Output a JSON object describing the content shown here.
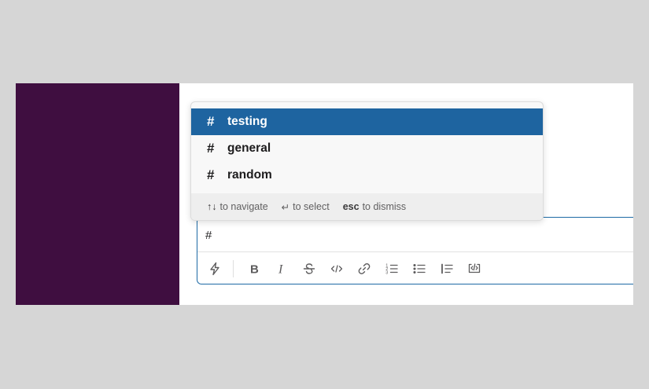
{
  "autocomplete": {
    "items": [
      {
        "prefix": "#",
        "label": "testing",
        "selected": true
      },
      {
        "prefix": "#",
        "label": "general",
        "selected": false
      },
      {
        "prefix": "#",
        "label": "random",
        "selected": false
      }
    ],
    "footer": {
      "navigate_keys": "↑↓",
      "navigate_label": "to navigate",
      "select_key": "↵",
      "select_label": "to select",
      "dismiss_key": "esc",
      "dismiss_label": "to dismiss"
    }
  },
  "composer": {
    "input_value": "#",
    "toolbar": [
      {
        "icon": "lightning-icon"
      },
      {
        "icon": "bold-icon"
      },
      {
        "icon": "italic-icon"
      },
      {
        "icon": "strikethrough-icon"
      },
      {
        "icon": "code-icon"
      },
      {
        "icon": "link-icon"
      },
      {
        "icon": "ordered-list-icon"
      },
      {
        "icon": "bulleted-list-icon"
      },
      {
        "icon": "blockquote-icon"
      },
      {
        "icon": "code-block-icon"
      }
    ]
  },
  "colors": {
    "sidebar": "#3f0e40",
    "selected_item": "#1e64a0",
    "composer_border": "#1d6aa5",
    "background": "#d6d6d6"
  }
}
